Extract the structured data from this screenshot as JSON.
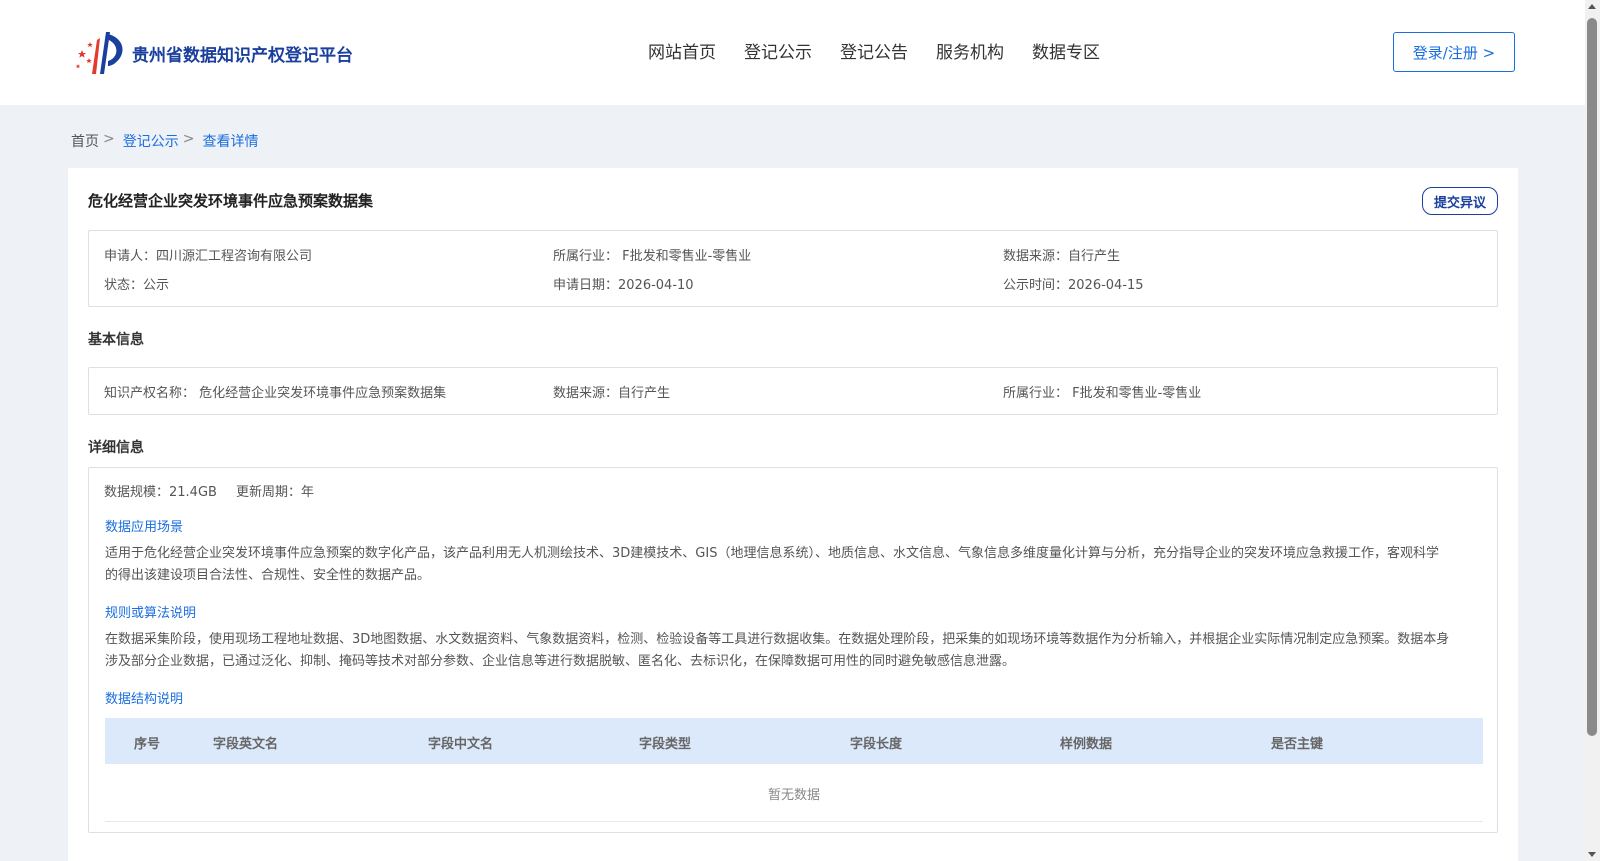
{
  "header": {
    "logo_text": "贵州省数据知识产权登记平台",
    "nav": [
      "网站首页",
      "登记公示",
      "登记公告",
      "服务机构",
      "数据专区"
    ],
    "login_label": "登录/注册 >"
  },
  "breadcrumb": {
    "home": "首页",
    "sep1": ">",
    "item1": "登记公示",
    "sep2": ">",
    "item2": "查看详情"
  },
  "detail": {
    "title": "危化经营企业突发环境事件应急预案数据集",
    "objection_label": "提交异议",
    "summary": {
      "applicant": "申请人：四川源汇工程咨询有限公司",
      "industry": "所属行业： F批发和零售业-零售业",
      "source": "数据来源：自行产生",
      "status": "状态：公示",
      "apply_date": "申请日期：2026-04-10",
      "publish_time": "公示时间：2026-04-15"
    },
    "basic": {
      "section_title": "基本信息",
      "ip_name": "知识产权名称： 危化经营企业突发环境事件应急预案数据集",
      "source": "数据来源：自行产生",
      "industry": "所属行业： F批发和零售业-零售业"
    },
    "detail_info": {
      "section_title": "详细信息",
      "scale": "数据规模：21.4GB",
      "cycle": "更新周期：年",
      "scenario_title": "数据应用场景",
      "scenario_text": "适用于危化经营企业突发环境事件应急预案的数字化产品，该产品利用无人机测绘技术、3D建模技术、GIS（地理信息系统）、地质信息、水文信息、气象信息多维度量化计算与分析，充分指导企业的突发环境应急救援工作，客观科学的得出该建设项目合法性、合规性、安全性的数据产品。",
      "rules_title": "规则或算法说明",
      "rules_text": "在数据采集阶段，使用现场工程地址数据、3D地图数据、水文数据资料、气象数据资料，检测、检验设备等工具进行数据收集。在数据处理阶段，把采集的如现场环境等数据作为分析输入，并根据企业实际情况制定应急预案。数据本身涉及部分企业数据，已通过泛化、抑制、掩码等技术对部分参数、企业信息等进行数据脱敏、匿名化、去标识化，在保障数据可用性的同时避免敏感信息泄露。",
      "structure_title": "数据结构说明",
      "table_headers": [
        "序号",
        "字段英文名",
        "字段中文名",
        "字段类型",
        "字段长度",
        "样例数据",
        "是否主键"
      ],
      "empty_text": "暂无数据"
    }
  },
  "colors": {
    "primary": "#1a6ee0",
    "brand": "#1a3f9c",
    "table_header_bg": "#dce9fb",
    "page_bg": "#eef1f5"
  }
}
